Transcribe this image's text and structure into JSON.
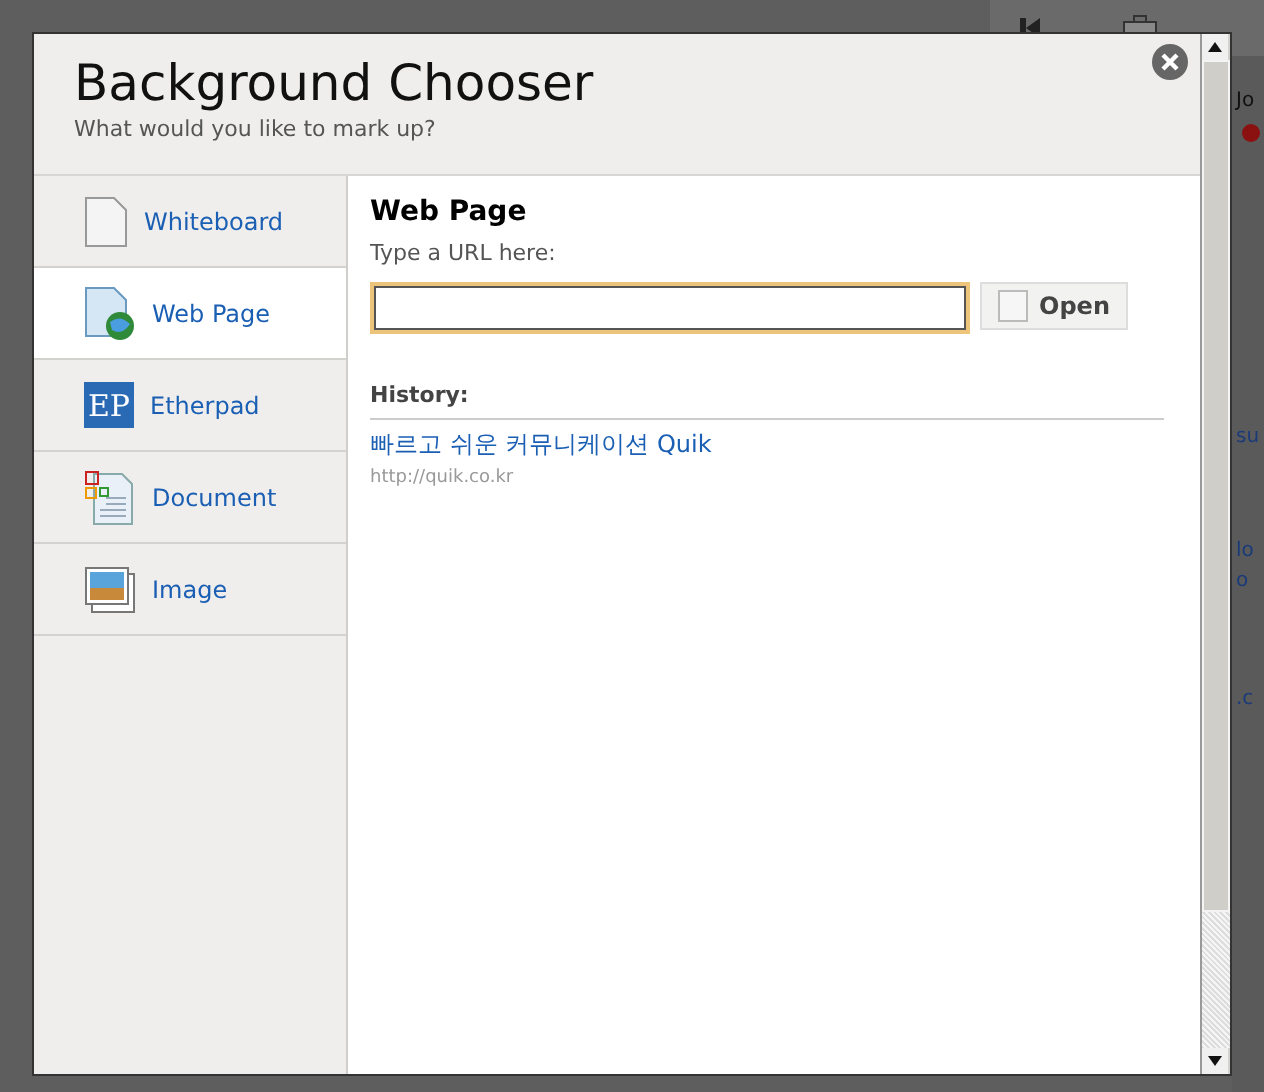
{
  "background": {
    "fragments": [
      "Jo",
      "su",
      "lo",
      "o",
      ".c"
    ]
  },
  "dialog": {
    "title": "Background Chooser",
    "subtitle": "What would you like to mark up?"
  },
  "sidebar": {
    "items": [
      {
        "kind": "whiteboard",
        "label": "Whiteboard",
        "selected": false
      },
      {
        "kind": "webpage",
        "label": "Web Page",
        "selected": true
      },
      {
        "kind": "etherpad",
        "label": "Etherpad",
        "icon_text": "EP",
        "selected": false
      },
      {
        "kind": "document",
        "label": "Document",
        "selected": false
      },
      {
        "kind": "image",
        "label": "Image",
        "selected": false
      }
    ]
  },
  "panel": {
    "heading": "Web Page",
    "url_label": "Type a URL here:",
    "open_button": "Open",
    "history_label": "History:",
    "history": [
      {
        "title": "빠르고 쉬운 커뮤니케이션 Quik",
        "url": "http://quik.co.kr"
      }
    ]
  }
}
